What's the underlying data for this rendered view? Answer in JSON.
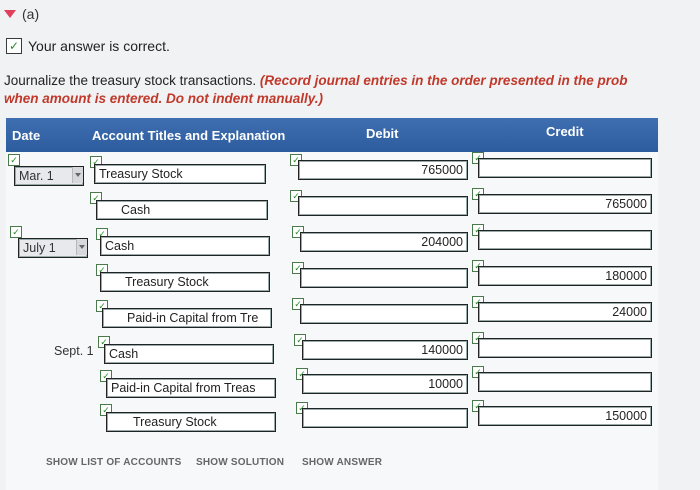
{
  "part_label": "(a)",
  "correct_message": "Your answer is correct.",
  "instructions": {
    "main": "Journalize the treasury stock transactions.",
    "note_line1": "(Record journal entries in the order presented in the prob",
    "note_line2": "when amount is entered. Do not indent manually.)"
  },
  "table": {
    "headers": {
      "date": "Date",
      "account": "Account Titles and Explanation",
      "debit": "Debit",
      "credit": "Credit"
    },
    "rows": [
      {
        "date": "Mar. 1",
        "account": "Treasury Stock",
        "debit": "765000",
        "credit": ""
      },
      {
        "date": "",
        "account": "Cash",
        "debit": "",
        "credit": "765000"
      },
      {
        "date": "July 1",
        "account": "Cash",
        "debit": "204000",
        "credit": ""
      },
      {
        "date": "",
        "account": "Treasury Stock",
        "debit": "",
        "credit": "180000"
      },
      {
        "date": "",
        "account": "Paid-in Capital from Tre",
        "debit": "",
        "credit": "24000"
      },
      {
        "date": "Sept. 1",
        "account": "Cash",
        "debit": "140000",
        "credit": ""
      },
      {
        "date": "",
        "account": "Paid-in Capital from Treas",
        "debit": "10000",
        "credit": ""
      },
      {
        "date": "",
        "account": "Treasury Stock",
        "debit": "",
        "credit": "150000"
      }
    ]
  },
  "footer": {
    "show_list": "SHOW LIST OF ACCOUNTS",
    "show_solution": "SHOW SOLUTION",
    "show_answer": "SHOW ANSWER"
  },
  "colors": {
    "header_bg": "#2c5c9e",
    "check": "#2a8a2a",
    "note": "#c0392b"
  }
}
